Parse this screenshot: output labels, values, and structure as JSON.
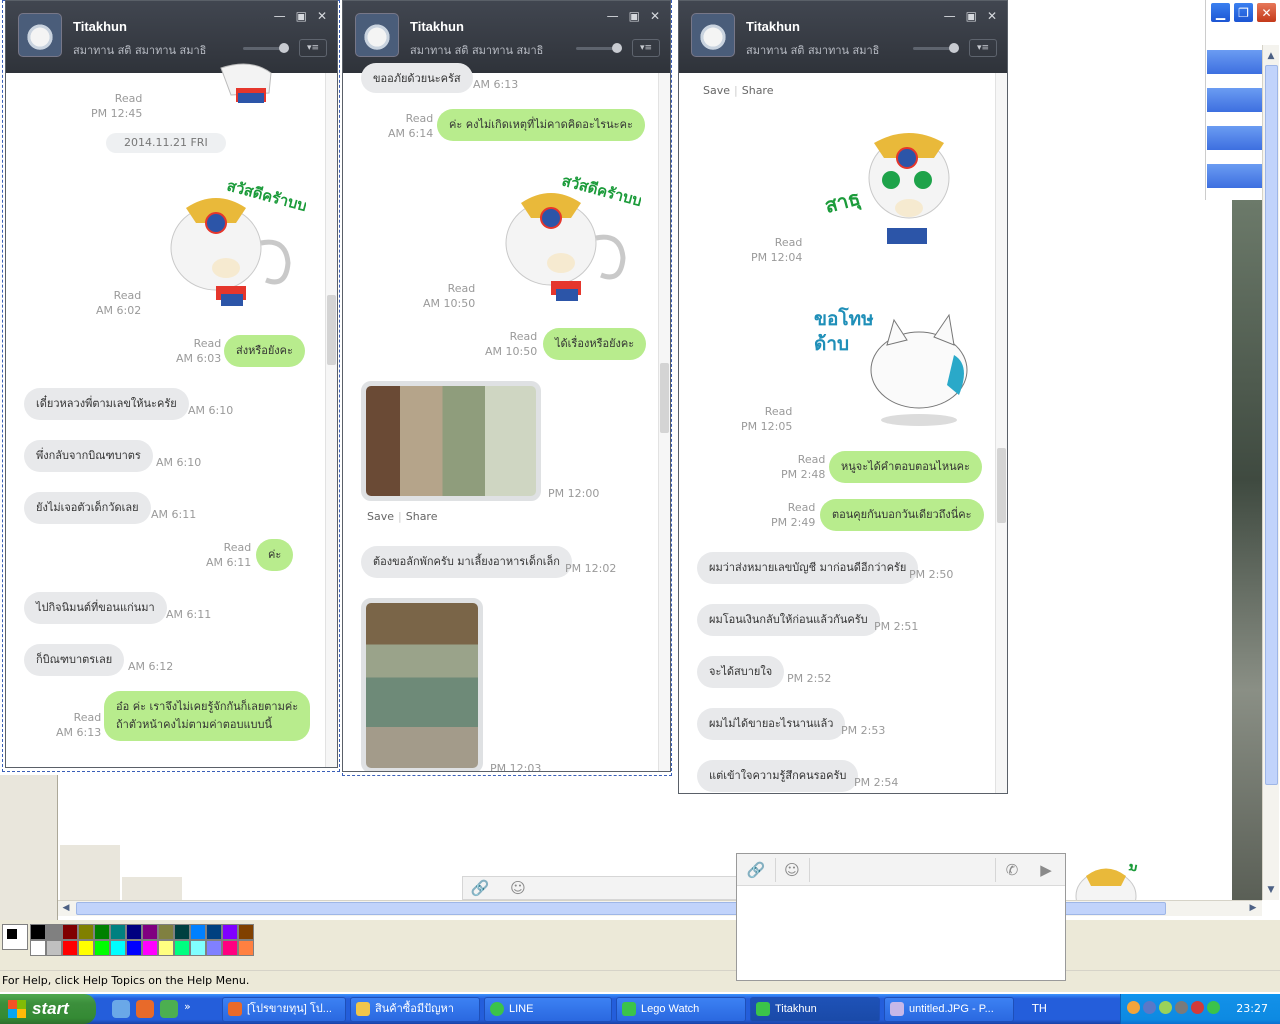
{
  "chat": {
    "contact_name": "Titakhun",
    "status": "สมาทาน สติ สมาทาน สมาธิ"
  },
  "window1": {
    "read_1245": "Read",
    "time_1245": "PM 12:45",
    "date_chip": "2014.11.21 FRI",
    "read_602": "Read",
    "time_602": "AM 6:02",
    "read_603": "Read",
    "time_603": "AM 6:03",
    "msg_603": "ส่งหรือยังคะ",
    "msg_610a": "เดี๋ยวหลวงพี่ตามเลขให้นะครัย",
    "time_610a": "AM 6:10",
    "msg_610b": "พึ่งกลับจากบิณฑบาตร",
    "time_610b": "AM 6:10",
    "msg_611a": "ยังไม่เจอตัวเด็กวัดเลย",
    "time_611a": "AM 6:11",
    "read_611": "Read",
    "time_611_read": "AM 6:11",
    "msg_611_out": "ค่ะ",
    "msg_611b": "ไปกิจนิมนต์ที่ขอนแก่นมา",
    "time_611b": "AM 6:11",
    "msg_612": "ก็บิณฑบาตรเลย",
    "time_612": "AM 6:12",
    "read_613": "Read",
    "time_613": "AM 6:13",
    "msg_613_line1": "อ๋อ ค่ะ เราจึงไม่เคยรู้จักกันก็เลยตามค่ะ",
    "msg_613_line2": "ถ้าตัวหน้าคงไม่ตามค่าตอบแบบนี้"
  },
  "window2": {
    "msg_top": "ขออภัยด้วยนะครัส",
    "time_top": "AM 6:13",
    "read_614": "Read",
    "time_614": "AM 6:14",
    "msg_614": "ค่ะ คงไม่เกิดเหตุที่ไม่คาดคิดอะไรนะคะ",
    "read_1050a": "Read",
    "time_1050a": "AM 10:50",
    "read_1050b": "Read",
    "time_1050b": "AM 10:50",
    "msg_1050": "ได้เรื่องหรือยังคะ",
    "time_photo1": "PM 12:00",
    "save": "Save",
    "share": "Share",
    "msg_1202": "ต้องขอลักพักครับ มาเลี้ยงอาหารเด็กเล็ก",
    "time_1202": "PM 12:02",
    "time_photo2": "PM 12:03"
  },
  "window3": {
    "save": "Save",
    "share": "Share",
    "sticker1_text": "สาธุ",
    "read_1204": "Read",
    "time_1204": "PM 12:04",
    "sticker2_text_1": "ขอโทษ",
    "sticker2_text_2": "ด้าบ",
    "read_1205": "Read",
    "time_1205": "PM 12:05",
    "read_248": "Read",
    "time_248": "PM 2:48",
    "msg_248": "หนูจะได้คำตอบตอนไหนคะ",
    "read_249": "Read",
    "time_249": "PM 2:49",
    "msg_249": "ตอนคุยกันบอกวันเดียวถึงนี่คะ",
    "msg_250": "ผมว่าส่งหมายเลขบัญชี มาก่อนดีอีกว่าครัย",
    "time_250": "PM 2:50",
    "msg_251": "ผมโอนเงินกลับให้ก่อนแล้วกันครับ",
    "time_251": "PM 2:51",
    "msg_252": "จะได้สบายใจ",
    "time_252": "PM 2:52",
    "msg_253": "ผมไม่ได้ขายอะไรนานแล้ว",
    "time_253": "PM 2:53",
    "msg_254": "แต่เข้าใจความรู้สึกคนรอครับ",
    "time_254": "PM 2:54"
  },
  "sticker_hanuman_text": "สวัสดีครัาบบ",
  "paint": {
    "status": "For Help, click Help Topics on the Help Menu."
  },
  "taskbar": {
    "start": "start",
    "items": [
      "[โปรขายทุน] โป...",
      "สินค้าซื้อมีปัญหา",
      "LINE",
      "Lego Watch",
      "Titakhun",
      "untitled.JPG - P..."
    ],
    "lang": "TH",
    "clock": "23:27"
  }
}
